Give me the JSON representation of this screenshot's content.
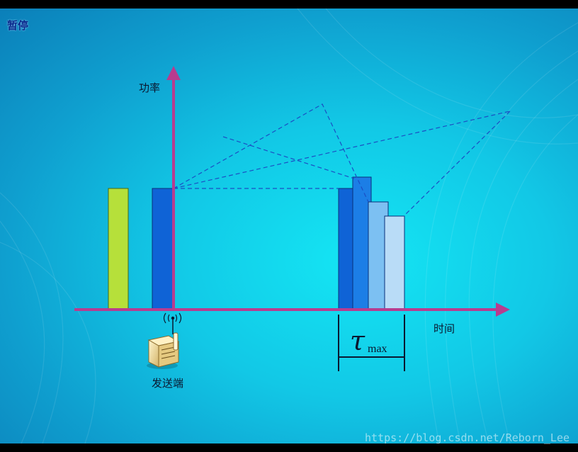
{
  "toolbar": {
    "pause_label": "暂停"
  },
  "axes": {
    "y_label": "功率",
    "x_label": "时间"
  },
  "transmitter": {
    "label": "发送端"
  },
  "delay_spread": {
    "symbol": "τ",
    "subscript": "max"
  },
  "watermark": "https://blog.csdn.net/Reborn_Lee",
  "colors": {
    "axis": "#b83c8f",
    "bar_green": "#b6e03a",
    "bar_blue": "#0f63d6",
    "bar_blue2": "#1c7ee6",
    "bar_light": "#7cc0f2",
    "bar_lighter": "#b9dcf7",
    "dash": "#1b4fc4"
  }
}
